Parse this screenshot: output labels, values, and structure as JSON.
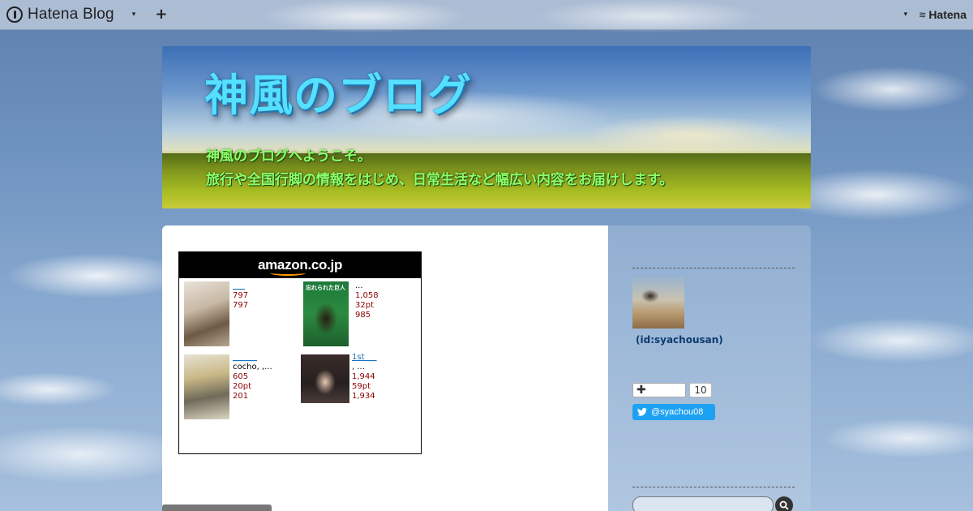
{
  "topbar": {
    "brand": "Hatena Blog",
    "add_label": "+",
    "menu_caret": "▾",
    "right_caret": "▾",
    "hatena_logo": "Hatena"
  },
  "header": {
    "title": "神風のブログ",
    "description_line1": "神風のブログへようこそ。",
    "description_line2": "旅行や全国行脚の情報をはじめ、日常生活など幅広い内容をお届けします。"
  },
  "amazon_widget": {
    "logo": "amazon.co.jp",
    "items": [
      {
        "link": "___",
        "lines": [
          "797",
          "797"
        ],
        "line_kinds": [
          "price",
          "price"
        ]
      },
      {
        "link": "",
        "lines": [
          "...",
          "1,058",
          "32pt",
          "985"
        ],
        "line_kinds": [
          "plain",
          "price",
          "price",
          "price"
        ],
        "cover_title": "忘れられた巨人"
      },
      {
        "link": "______",
        "lines": [
          "cocho, ,...",
          "605",
          "20pt",
          "201"
        ],
        "line_kinds": [
          "plain",
          "price",
          "price",
          "price"
        ]
      },
      {
        "link": "1st___",
        "lines": [
          ", ...",
          "1,944",
          "59pt",
          "1,934"
        ],
        "line_kinds": [
          "plain",
          "price",
          "price",
          "price"
        ]
      }
    ]
  },
  "sidebar": {
    "profile_id": "(id:syachousan)",
    "hatena_star_count": "10",
    "twitter_handle": "@syachou08"
  },
  "colors": {
    "title": "#55e0ff",
    "description": "#8cff6a",
    "price": "#8b0000",
    "link": "#1a73c0",
    "twitter": "#1da1f2"
  }
}
